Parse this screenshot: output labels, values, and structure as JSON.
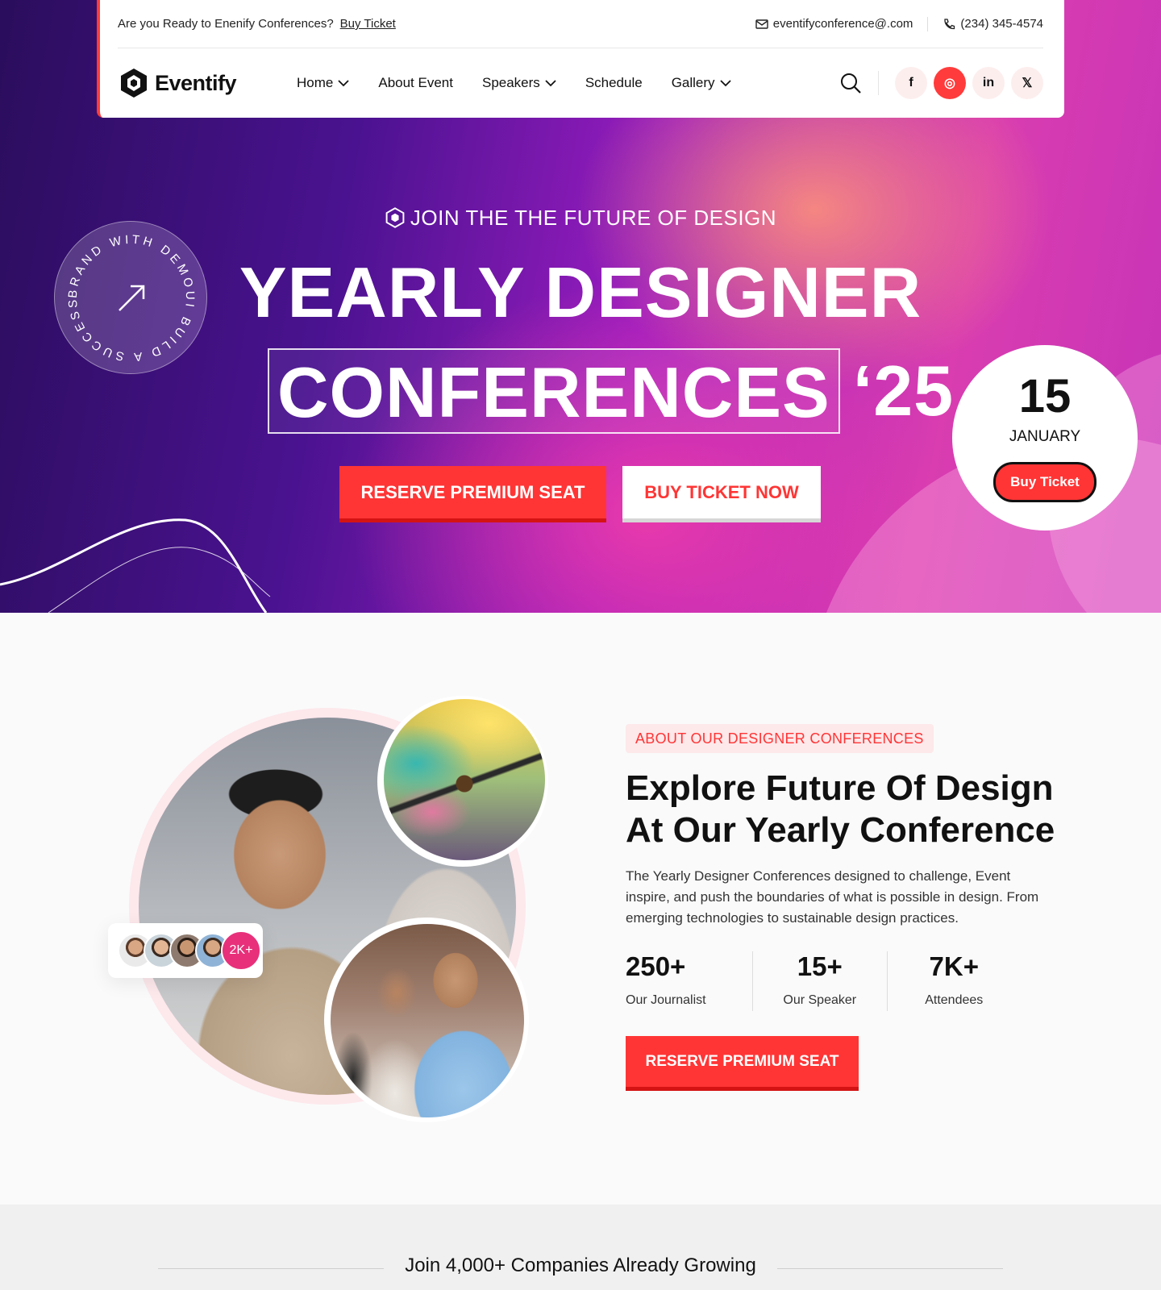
{
  "topbar": {
    "announcement": "Are you Ready to Enenify Conferences?",
    "announcement_link": "Buy Ticket",
    "email": "eventifyconference@.com",
    "phone": "(234) 345-4574"
  },
  "nav": {
    "logo": "Eventify",
    "items": [
      {
        "label": "Home",
        "dropdown": true
      },
      {
        "label": "About Event",
        "dropdown": false
      },
      {
        "label": "Speakers",
        "dropdown": true
      },
      {
        "label": "Schedule",
        "dropdown": false
      },
      {
        "label": "Gallery",
        "dropdown": true
      }
    ],
    "social": [
      {
        "icon": "facebook-icon",
        "glyph": "f"
      },
      {
        "icon": "instagram-icon",
        "glyph": "◎"
      },
      {
        "icon": "linkedin-icon",
        "glyph": "in"
      },
      {
        "icon": "x-icon",
        "glyph": "𝕏"
      }
    ]
  },
  "hero": {
    "eyebrow": "JOIN THE THE FUTURE OF DESIGN",
    "title_line1": "YEARLY DESIGNER",
    "title_boxed": "CONFERENCES",
    "title_year": "‘25",
    "primary_button": "RESERVE PREMIUM SEAT",
    "secondary_button": "BUY TICKET NOW",
    "badge_text": "BRAND WITH DEMOUI BUILD A SUCCESS",
    "date_day": "15",
    "date_month": "JANUARY",
    "date_button": "Buy Ticket"
  },
  "about": {
    "tag": "ABOUT OUR DESIGNER CONFERENCES",
    "title": "Explore Future Of Design At Our Yearly Conference",
    "paragraph": "The Yearly Designer Conferences designed to challenge, Event inspire, and push the boundaries of what is possible in design. From emerging technologies to sustainable design practices.",
    "avatars_count": "2K+",
    "stats": [
      {
        "value": "250+",
        "label": "Our Journalist"
      },
      {
        "value": "15+",
        "label": "Our Speaker"
      },
      {
        "value": "7K+",
        "label": "Attendees"
      }
    ],
    "button": "RESERVE PREMIUM SEAT"
  },
  "companies": {
    "heading": "Join 4,000+ Companies Already Growing"
  },
  "colors": {
    "accent": "#ff3535",
    "hero_dark": "#2a0d5c",
    "hero_pink": "#d93db0"
  }
}
